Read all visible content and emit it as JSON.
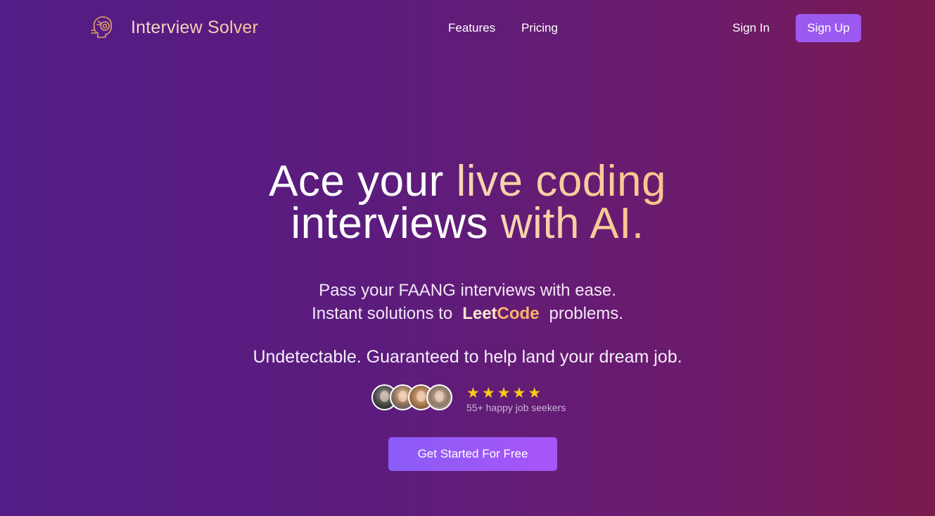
{
  "nav": {
    "brand_name": "Interview Solver",
    "links": [
      {
        "label": "Features"
      },
      {
        "label": "Pricing"
      }
    ],
    "sign_in_label": "Sign In",
    "sign_up_label": "Sign Up"
  },
  "hero": {
    "headline_line1_plain": "Ace your ",
    "headline_line1_gold": "live coding",
    "headline_line2_plain": "interviews ",
    "headline_line2_gold": "with AI.",
    "sub_line1": "Pass your FAANG interviews with ease.",
    "sub_line2_before": "Instant solutions to",
    "leetcode_leet": "Leet",
    "leetcode_code": "Code",
    "sub_line2_after": "problems.",
    "tagline": "Undetectable. Guaranteed to help land your dream job.",
    "rating_stars": 5,
    "stars_text": "★★★★★",
    "happy_seekers": "55+ happy job seekers",
    "cta_label": "Get Started For Free"
  },
  "colors": {
    "background_start": "#531c86",
    "background_end": "#7a1a4e",
    "accent_gold": "#f9c68c",
    "button_purple": "#9b59ef",
    "star_yellow": "#facc15"
  },
  "icons": {
    "brand_logo": "robot-head-icon",
    "rating": "star-icon"
  }
}
